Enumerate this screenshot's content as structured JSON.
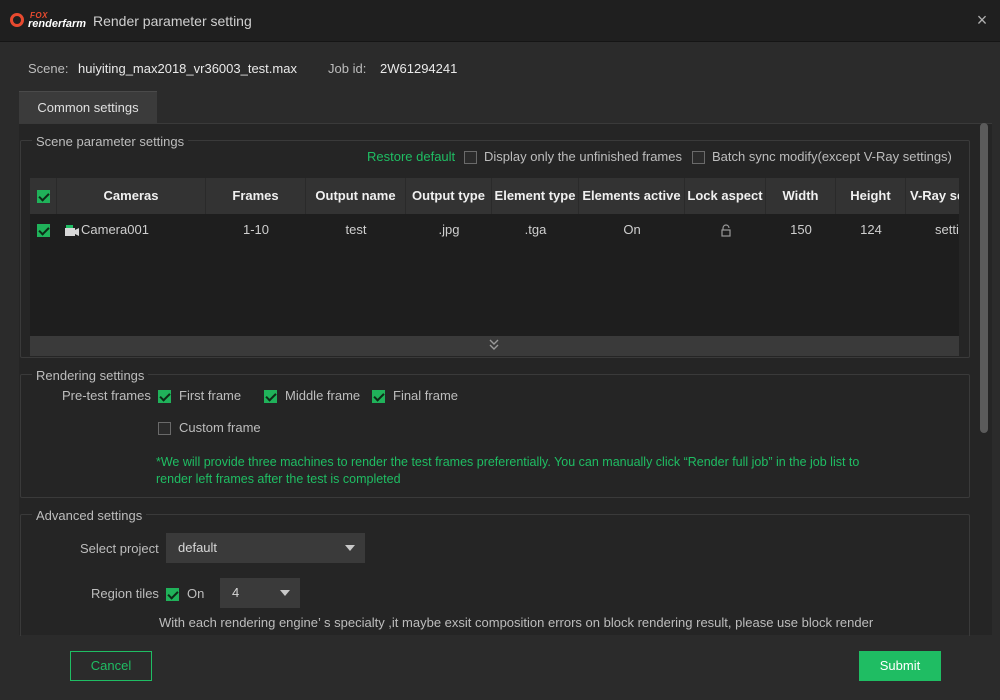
{
  "window": {
    "logo_top": "FOX",
    "logo_text": "renderfarm",
    "title": "Render parameter setting",
    "close_icon": "×"
  },
  "info": {
    "scene_label": "Scene:",
    "scene_value": "huiyiting_max2018_vr36003_test.max",
    "job_label": "Job id:",
    "job_value": "2W61294241"
  },
  "tabs": [
    {
      "label": "Common settings",
      "active": true
    }
  ],
  "scene_params": {
    "title": "Scene parameter settings",
    "restore_default": "Restore default",
    "display_unfinished": "Display only the unfinished frames",
    "batch_sync": "Batch sync modify(except V-Ray settings)",
    "columns": [
      "Cameras",
      "Frames",
      "Output name",
      "Output type",
      "Element type",
      "Elements active",
      "Lock aspect",
      "Width",
      "Height",
      "V-Ray se"
    ],
    "rows": [
      {
        "checked": true,
        "camera": "Camera001",
        "frames": "1-10",
        "output_name": "test",
        "output_type": ".jpg",
        "element_type": ".tga",
        "elements_active": "On",
        "lock_aspect": "unlocked",
        "width": "150",
        "height": "124",
        "vray": "setti"
      }
    ]
  },
  "rendering": {
    "title": "Rendering settings",
    "pretest_label": "Pre-test frames",
    "first_frame": "First frame",
    "middle_frame": "Middle frame",
    "final_frame": "Final frame",
    "custom_frame": "Custom frame",
    "note_line1": "*We will provide three machines to render the test frames preferentially. You can manually click “Render full job” in the job list to",
    "note_line2": "render left frames after the test is completed"
  },
  "advanced": {
    "title": "Advanced settings",
    "select_project_label": "Select project",
    "select_project_value": "default",
    "region_tiles_label": "Region tiles",
    "region_on": "On",
    "region_value": "4",
    "note": "With each rendering engine’ s specialty ,it maybe exsit composition errors on block rendering result, please use block render"
  },
  "footer": {
    "cancel": "Cancel",
    "submit": "Submit"
  },
  "colors": {
    "accent": "#1fbd63",
    "brand": "#e84a2f",
    "bg": "#2b2b2b"
  }
}
